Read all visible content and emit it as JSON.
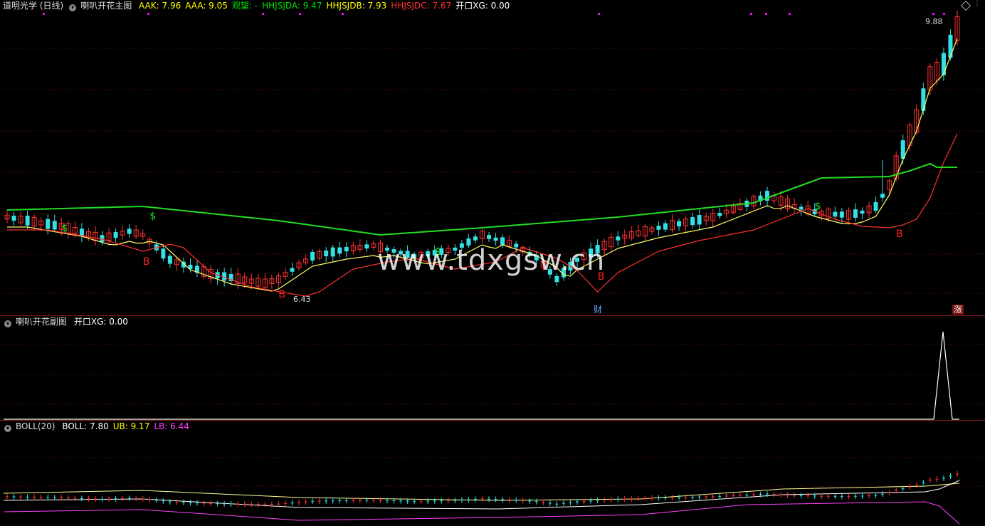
{
  "main": {
    "stock_name": "道明光学 (日线)",
    "indicator_name": "喇叭开花主图",
    "items": [
      {
        "label": "AAK: 7.96",
        "color": "#ffff00"
      },
      {
        "label": "AAA: 9.05",
        "color": "#ffff00"
      },
      {
        "label": "观望: -",
        "color": "#00e000"
      },
      {
        "label": "HHJSJDA: 9.47",
        "color": "#00e000"
      },
      {
        "label": "HHJSJDB: 7.93",
        "color": "#ffff00"
      },
      {
        "label": "HHJSJDC: 7.67",
        "color": "#ff3030"
      },
      {
        "label": "开口XG: 0.00",
        "color": "#ffffff"
      }
    ],
    "high_label": "9.88",
    "low_label": "6.43",
    "markers": {
      "buy": "B",
      "sell": "$",
      "finance": "财",
      "limit_up": "涨"
    }
  },
  "sub": {
    "indicator_name": "喇叭开花副图",
    "items": [
      {
        "label": "开口XG: 0.00",
        "color": "#ffffff"
      }
    ]
  },
  "boll": {
    "indicator_name": "BOLL(20)",
    "items": [
      {
        "label": "BOLL: 7.80",
        "color": "#ffffff"
      },
      {
        "label": "UB: 9.17",
        "color": "#ffff00"
      },
      {
        "label": "LB: 6.44",
        "color": "#ff40ff"
      }
    ]
  },
  "watermark": "www.tdxgsw.cn",
  "colors": {
    "up": "#ff3232",
    "down": "#33e0e6",
    "mid_line": "#ffff66",
    "ma_red": "#ff3030",
    "upper_band": "#22dd22",
    "grid": "#7a1010"
  }
}
